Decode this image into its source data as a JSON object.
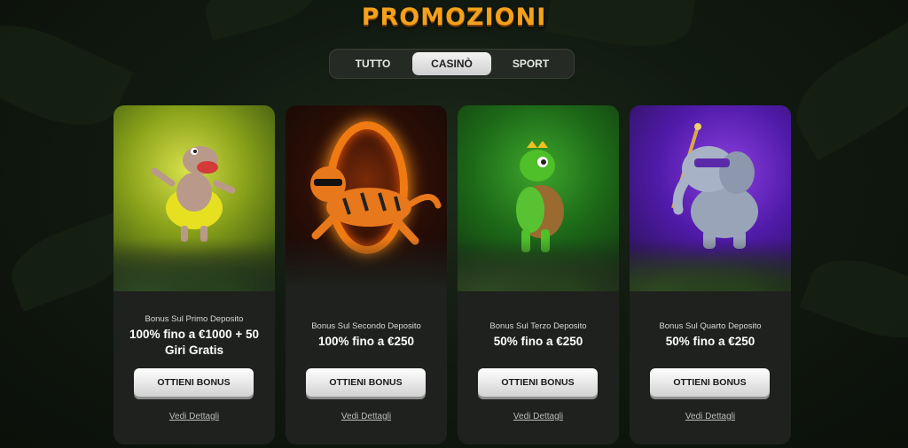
{
  "page": {
    "title": "PROMOZIONI"
  },
  "tabs": [
    {
      "label": "TUTTO",
      "active": false
    },
    {
      "label": "CASINÒ",
      "active": true
    },
    {
      "label": "SPORT",
      "active": false
    }
  ],
  "cards": [
    {
      "mascot": "hippo",
      "subtitle": "Bonus Sul Primo Deposito",
      "offer": "100% fino a €1000 + 50 Giri Gratis",
      "button": "OTTIENI BONUS",
      "details": "Vedi Dettagli"
    },
    {
      "mascot": "tiger",
      "subtitle": "Bonus Sul Secondo Deposito",
      "offer": "100% fino a €250",
      "button": "OTTIENI BONUS",
      "details": "Vedi Dettagli"
    },
    {
      "mascot": "turtle",
      "subtitle": "Bonus Sul Terzo Deposito",
      "offer": "50% fino a €250",
      "button": "OTTIENI BONUS",
      "details": "Vedi Dettagli"
    },
    {
      "mascot": "elephant",
      "subtitle": "Bonus Sul Quarto Deposito",
      "offer": "50% fino a €250",
      "button": "OTTIENI BONUS",
      "details": "Vedi Dettagli"
    }
  ],
  "colors": {
    "title": "#f2a21b",
    "card_bg": "#1e211d",
    "tab_active": "#e6e6e6"
  }
}
